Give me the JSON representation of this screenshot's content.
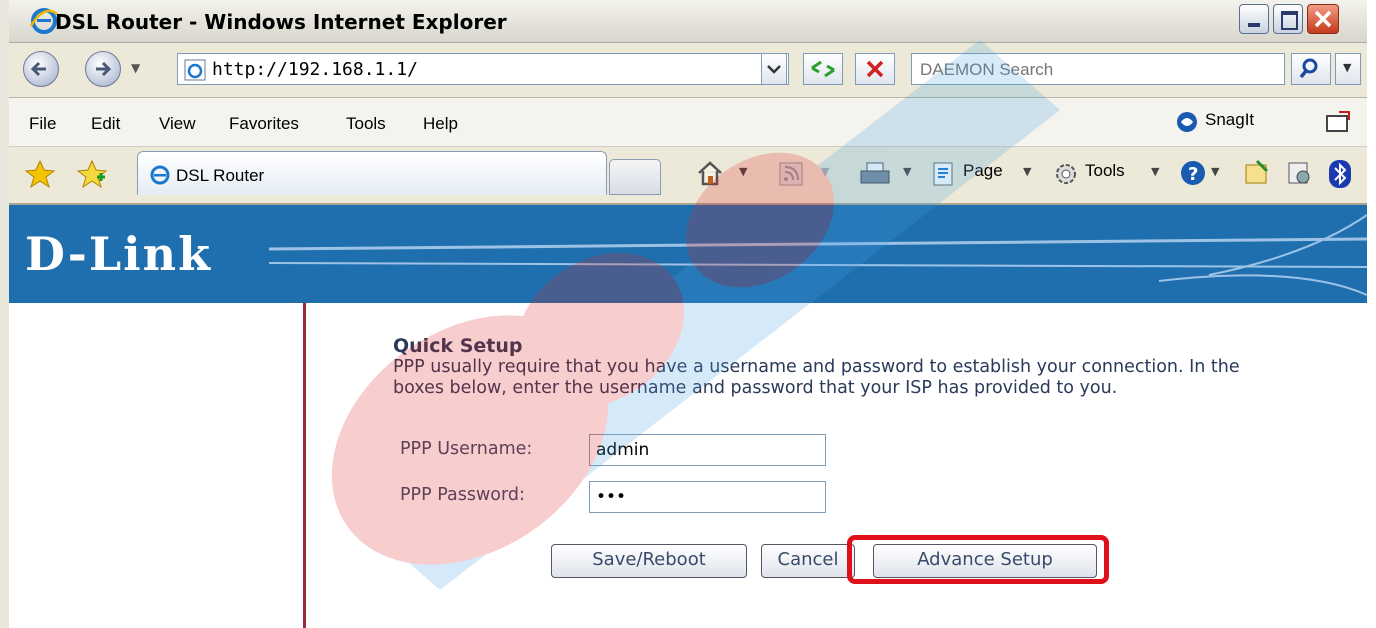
{
  "window": {
    "title": "DSL Router - Windows Internet Explorer"
  },
  "address_bar": {
    "url": "http://192.168.1.1/",
    "search_placeholder": "DAEMON Search"
  },
  "menu": {
    "items": [
      "File",
      "Edit",
      "View",
      "Favorites",
      "Tools",
      "Help"
    ],
    "snagit_label": "SnagIt"
  },
  "tab": {
    "title": "DSL Router"
  },
  "command_bar": {
    "page_label": "Page",
    "tools_label": "Tools"
  },
  "router": {
    "logo": "D-Link",
    "section_title": "Quick Setup",
    "description": "PPP usually require that you have a username and password to establish your connection. In the boxes below, enter the username and password that your ISP has provided to you.",
    "username_label": "PPP Username:",
    "username_value": "admin",
    "password_label": "PPP Password:",
    "password_value": "•••",
    "buttons": {
      "save": "Save/Reboot",
      "cancel": "Cancel",
      "advance": "Advance Setup"
    }
  },
  "colors": {
    "banner": "#1f6fae",
    "highlight": "#e0101a",
    "divider": "#9b2a3a"
  },
  "icons": [
    "back-icon",
    "forward-icon",
    "ie-page-icon",
    "refresh-icon",
    "stop-icon",
    "search-icon",
    "favorites-star-icon",
    "add-favorites-icon",
    "home-icon",
    "feeds-icon",
    "print-icon",
    "page-icon",
    "tools-gear-icon",
    "help-icon",
    "bluetooth-icon"
  ]
}
